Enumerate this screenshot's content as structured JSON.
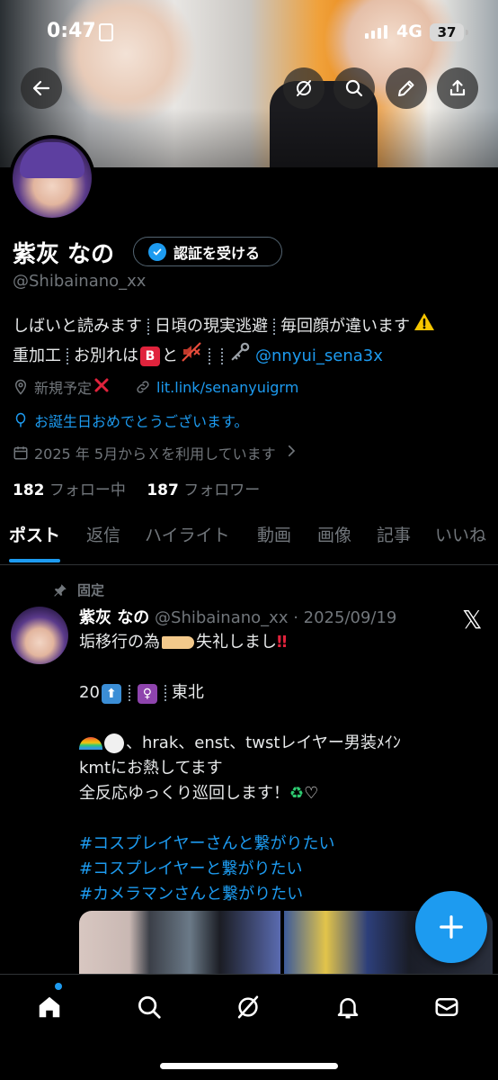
{
  "status_bar": {
    "time": "0:47",
    "network": "4G",
    "battery": "37"
  },
  "profile": {
    "display_name": "紫灰 なの",
    "verify_button": "認証を受ける",
    "handle": "@Shibainano_xx",
    "bio": {
      "line1": [
        "しばいと読みます",
        "日頃の現実逃避",
        "毎回顔が違います"
      ],
      "line2_a": "重加工",
      "line2_b": "お別れは",
      "line2_b_emoji": "B",
      "line2_c": "と",
      "line2_link": "@nnyui_sena3x"
    },
    "location": "新規予定",
    "website": "lit.link/senanyuigrm",
    "birthday": "お誕生日おめでとうございます。",
    "joined": "2025 年 5月からＸを利用しています",
    "following_count": "182",
    "following_label": "フォロー中",
    "followers_count": "187",
    "followers_label": "フォロワー"
  },
  "tabs": [
    "ポスト",
    "返信",
    "ハイライト",
    "動画",
    "画像",
    "記事",
    "いいね"
  ],
  "pinned_label": "固定",
  "post": {
    "author": "紫灰 なの",
    "meta": "@Shibainano_xx · 2025/09/19",
    "line1": "垢移行の為",
    "line1_b": "失礼しまし",
    "line2_a": "20",
    "line2_b": "東北",
    "line3": "、hrak、enst、twstレイヤー男装ﾒｲﾝ",
    "line4": "kmtにお熱してます",
    "line5": "全反応ゆっくり巡回します！",
    "hashtags": [
      "#コスプレイヤーさんと繋がりたい",
      "#コスプレイヤーと繋がりたい",
      "#カメラマンさんと繋がりたい"
    ]
  },
  "icons": [
    "back-arrow-icon",
    "grok-icon",
    "search-icon",
    "pencil-icon",
    "share-icon",
    "home-icon",
    "notifications-icon",
    "messages-icon"
  ],
  "colors": {
    "accent": "#1d9bf0",
    "background": "#000000",
    "secondary_text": "#71767b"
  }
}
